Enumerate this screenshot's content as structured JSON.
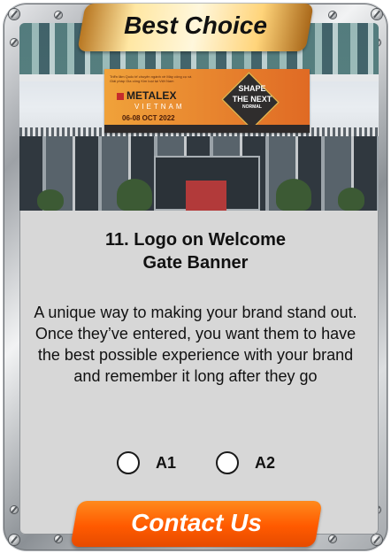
{
  "card": {
    "badge": "Best Choice",
    "title_line1": "11. Logo on Welcome",
    "title_line2": "Gate Banner",
    "description": "A unique way to making your brand stand out. Once they’ve entered, you want them to have the best possible experience with your brand and remember it long after they go",
    "options": [
      {
        "label": "A1",
        "selected": false
      },
      {
        "label": "A2",
        "selected": false
      }
    ],
    "cta_label": "Contact Us"
  },
  "photo": {
    "banner_small_text": "Triển lãm Quốc tế chuyên ngành về Máy công cụ và Giải pháp Gia công Kim loại tại Việt Nam",
    "banner_brand": "METALEX",
    "banner_sub": "VIETNAM",
    "banner_date": "06-08 OCT 2022",
    "banner_shape_line1": "SHAPE",
    "banner_shape_line2": "THE NEXT",
    "banner_shape_line3": "NORMAL"
  },
  "colors": {
    "badge_gold": "#ffe7a3",
    "cta_orange": "#ff5a00",
    "panel_gray": "#d7d7d7"
  }
}
